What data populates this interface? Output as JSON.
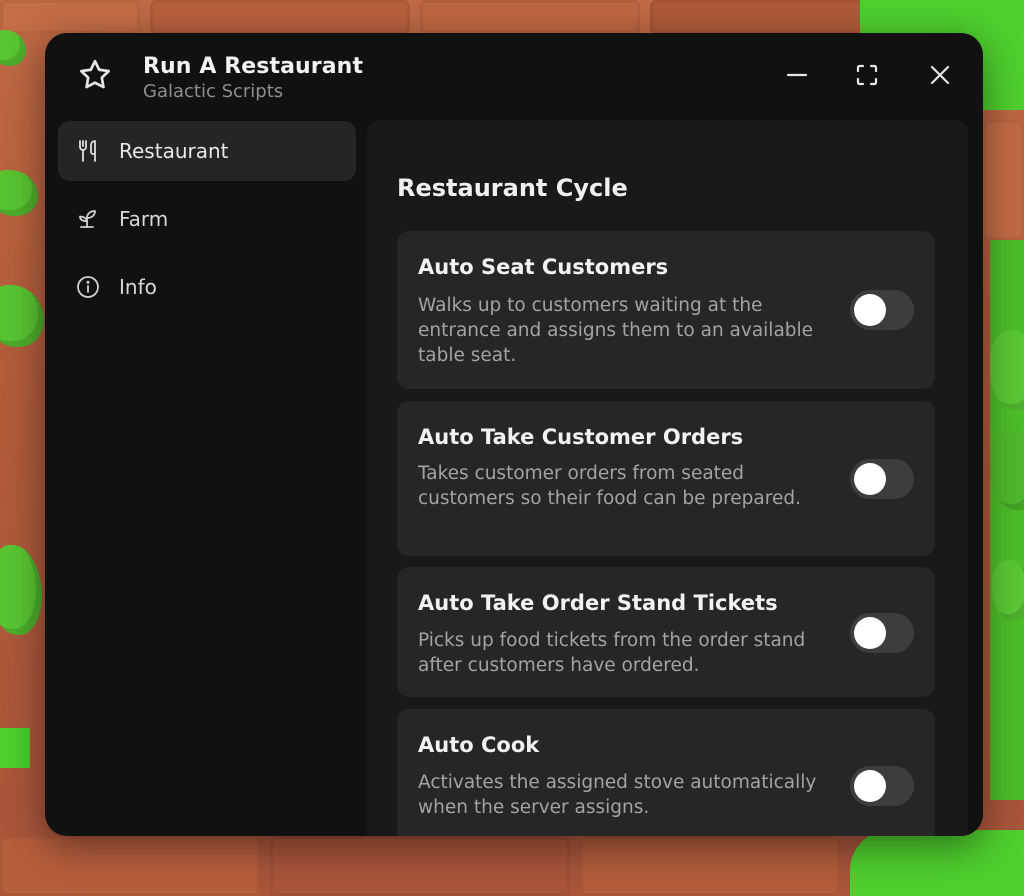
{
  "window": {
    "title": "Run A Restaurant",
    "subtitle": "Galactic Scripts",
    "icon": "star-icon",
    "controls": [
      "minimize-icon",
      "maximize-icon",
      "close-icon"
    ]
  },
  "sidebar": {
    "items": [
      {
        "label": "Restaurant",
        "icon": "fork-knife-icon",
        "active": true
      },
      {
        "label": "Farm",
        "icon": "sprout-icon",
        "active": false
      },
      {
        "label": "Info",
        "icon": "info-icon",
        "active": false
      }
    ]
  },
  "main": {
    "section_title": "Restaurant Cycle",
    "cards": [
      {
        "title": "Auto Seat Customers",
        "description": "Walks up to customers waiting at the entrance and assigns them to an available table seat.",
        "enabled": false
      },
      {
        "title": "Auto Take Customer Orders",
        "description": "Takes customer orders from seated customers so their food can be prepared.",
        "enabled": false
      },
      {
        "title": "Auto Take Order Stand Tickets",
        "description": "Picks up food tickets from the order stand after customers have ordered.",
        "enabled": false
      },
      {
        "title": "Auto Cook",
        "description": "Activates the assigned stove automatically when the server assigns.",
        "enabled": false
      }
    ]
  },
  "colors": {
    "window_bg": "#111111",
    "panel_bg": "#191919",
    "card_bg": "#262626",
    "active_nav_bg": "#252525",
    "toggle_off": "#3d3d3d",
    "knob": "#ffffff",
    "text_primary": "#f2f2f2",
    "text_secondary": "#a3a3a3"
  }
}
